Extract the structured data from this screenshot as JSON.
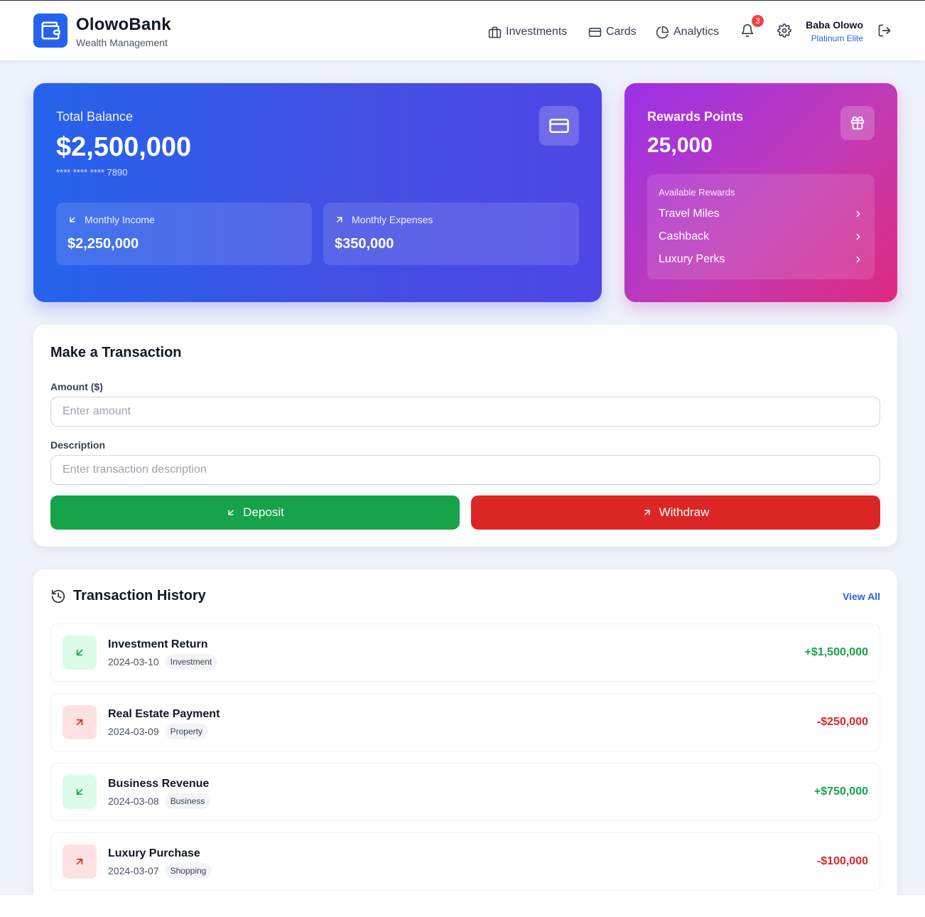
{
  "header": {
    "brand": "OlowoBank",
    "tagline": "Wealth Management",
    "nav": [
      {
        "label": "Investments",
        "icon": "briefcase-icon"
      },
      {
        "label": "Cards",
        "icon": "credit-card-icon"
      },
      {
        "label": "Analytics",
        "icon": "pie-chart-icon"
      }
    ],
    "notification_count": "3",
    "user": {
      "name": "Baba Olowo",
      "tier": "Platinum Elite"
    }
  },
  "balance": {
    "label": "Total Balance",
    "amount": "$2,500,000",
    "account": "**** **** **** 7890",
    "income_label": "Monthly Income",
    "income_value": "$2,250,000",
    "expenses_label": "Monthly Expenses",
    "expenses_value": "$350,000"
  },
  "rewards": {
    "label": "Rewards Points",
    "points": "25,000",
    "panel_title": "Available Rewards",
    "items": [
      "Travel Miles",
      "Cashback",
      "Luxury Perks"
    ]
  },
  "transaction_form": {
    "title": "Make a Transaction",
    "amount_label": "Amount ($)",
    "amount_placeholder": "Enter amount",
    "description_label": "Description",
    "description_placeholder": "Enter transaction description",
    "deposit_label": "Deposit",
    "withdraw_label": "Withdraw"
  },
  "history": {
    "title": "Transaction History",
    "view_all": "View All",
    "transactions": [
      {
        "name": "Investment Return",
        "date": "2024-03-10",
        "category": "Investment",
        "amount": "+$1,500,000",
        "direction": "in"
      },
      {
        "name": "Real Estate Payment",
        "date": "2024-03-09",
        "category": "Property",
        "amount": "-$250,000",
        "direction": "out"
      },
      {
        "name": "Business Revenue",
        "date": "2024-03-08",
        "category": "Business",
        "amount": "+$750,000",
        "direction": "in"
      },
      {
        "name": "Luxury Purchase",
        "date": "2024-03-07",
        "category": "Shopping",
        "amount": "-$100,000",
        "direction": "out"
      }
    ]
  },
  "colors": {
    "primary": "#2563eb",
    "success": "#16a34a",
    "danger": "#dc2626",
    "rewards_start": "#9b30e8",
    "rewards_end": "#de2a80"
  }
}
